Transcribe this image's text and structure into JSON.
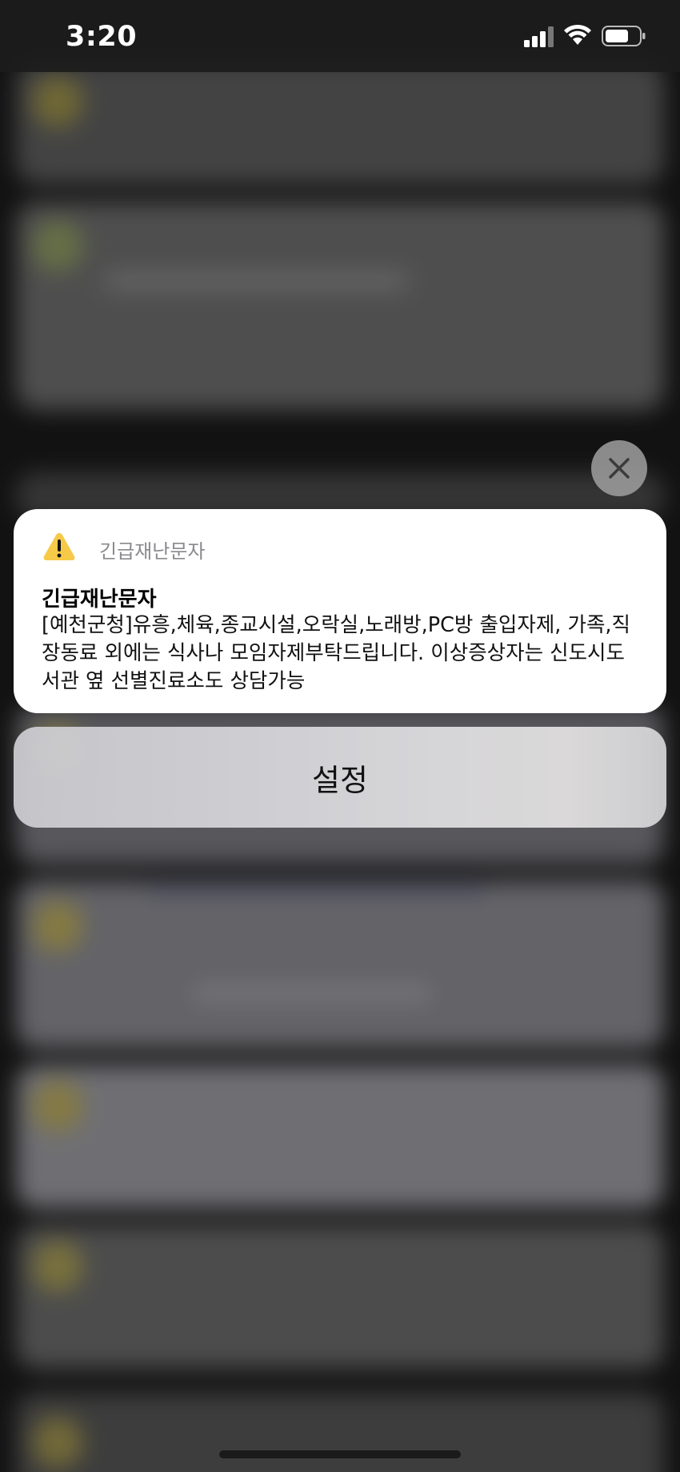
{
  "status_bar": {
    "time": "3:20",
    "icons": [
      "signal-icon",
      "wifi-icon",
      "battery-icon"
    ]
  },
  "alert": {
    "app_icon": "warning-icon",
    "app_name": "긴급재난문자",
    "title": "긴급재난문자",
    "body": "[예천군청]유흥,체육,종교시설,오락실,노래방,PC방 출입자제, 가족,직장동료 외에는 식사나 모임자제부탁드립니다. 이상증상자는 신도시도서관 옆 선별진료소도 상담가능"
  },
  "actions": {
    "close_icon": "close-icon",
    "settings_label": "설정"
  },
  "colors": {
    "warning_yellow": "#F7C948",
    "card_background": "#FFFFFF",
    "app_name_gray": "#8A8A8E"
  }
}
